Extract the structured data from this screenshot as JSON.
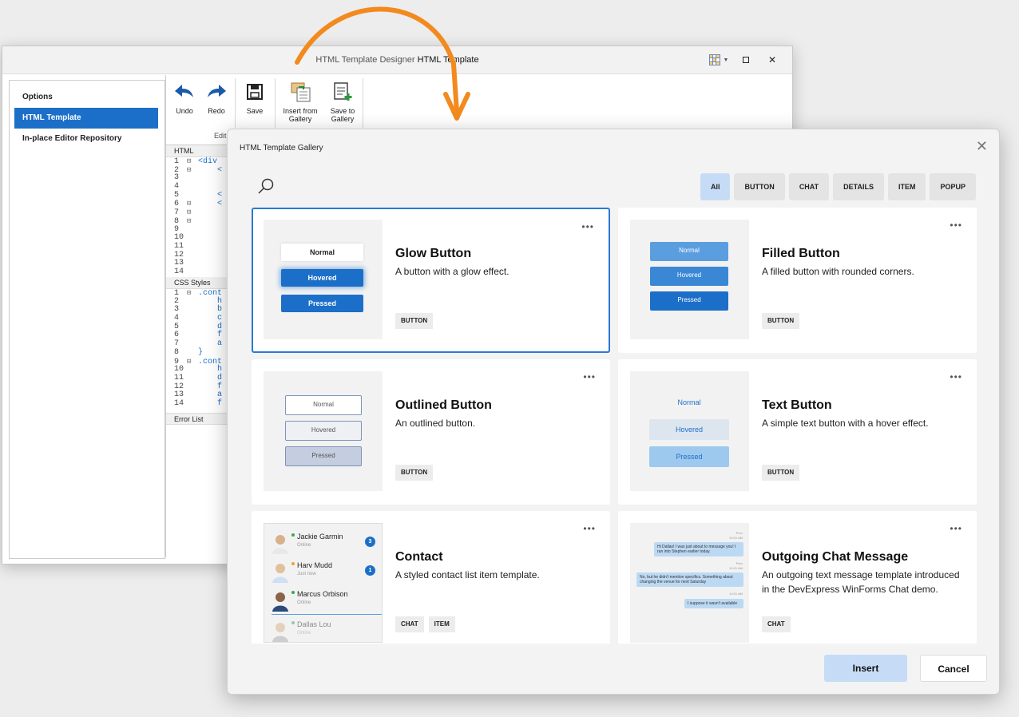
{
  "designer": {
    "title_prefix": "HTML Template Designer",
    "title_suffix": "HTML Template",
    "nav": [
      "Options",
      "HTML Template",
      "In-place Editor Repository"
    ],
    "ribbon": {
      "undo": "Undo",
      "redo": "Redo",
      "save": "Save",
      "insert_line1": "Insert from",
      "insert_line2": "Gallery",
      "saveto_line1": "Save to",
      "saveto_line2": "Gallery",
      "group_label": "Edit"
    },
    "html_panel": "HTML",
    "css_panel": "CSS Styles",
    "error_panel": "Error List",
    "html_lines": [
      {
        "n": "1",
        "f": "⊟",
        "t": "<div"
      },
      {
        "n": "2",
        "f": "⊟",
        "t": "    <"
      },
      {
        "n": "3",
        "f": "",
        "t": ""
      },
      {
        "n": "4",
        "f": "",
        "t": ""
      },
      {
        "n": "5",
        "f": "",
        "t": "    <"
      },
      {
        "n": "6",
        "f": "⊟",
        "t": "    <"
      },
      {
        "n": "7",
        "f": "⊟",
        "t": ""
      },
      {
        "n": "8",
        "f": "⊟",
        "t": ""
      },
      {
        "n": "9",
        "f": "",
        "t": ""
      },
      {
        "n": "10",
        "f": "",
        "t": ""
      },
      {
        "n": "11",
        "f": "",
        "t": ""
      },
      {
        "n": "12",
        "f": "",
        "t": ""
      },
      {
        "n": "13",
        "f": "",
        "t": ""
      },
      {
        "n": "14",
        "f": "",
        "t": ""
      }
    ],
    "css_lines": [
      {
        "n": "1",
        "f": "⊟",
        "t": ".cont"
      },
      {
        "n": "2",
        "f": "",
        "t": "    h"
      },
      {
        "n": "3",
        "f": "",
        "t": "    b"
      },
      {
        "n": "4",
        "f": "",
        "t": "    c"
      },
      {
        "n": "5",
        "f": "",
        "t": "    d"
      },
      {
        "n": "6",
        "f": "",
        "t": "    f"
      },
      {
        "n": "7",
        "f": "",
        "t": "    a"
      },
      {
        "n": "8",
        "f": "",
        "t": "}"
      },
      {
        "n": "9",
        "f": "⊟",
        "t": ".cont"
      },
      {
        "n": "10",
        "f": "",
        "t": "    h"
      },
      {
        "n": "11",
        "f": "",
        "t": "    d"
      },
      {
        "n": "12",
        "f": "",
        "t": "    f"
      },
      {
        "n": "13",
        "f": "",
        "t": "    a"
      },
      {
        "n": "14",
        "f": "",
        "t": "    f"
      }
    ]
  },
  "gallery": {
    "title": "HTML Template Gallery",
    "close": "✕",
    "filters": [
      "All",
      "BUTTON",
      "CHAT",
      "DETAILS",
      "ITEM",
      "POPUP"
    ],
    "cards": [
      {
        "title": "Glow Button",
        "desc": "A button with a glow effect.",
        "tags": [
          "BUTTON"
        ],
        "preview": [
          "Normal",
          "Hovered",
          "Pressed"
        ]
      },
      {
        "title": "Filled Button",
        "desc": "A filled button with rounded corners.",
        "tags": [
          "BUTTON"
        ],
        "preview": [
          "Normal",
          "Hovered",
          "Pressed"
        ]
      },
      {
        "title": "Outlined Button",
        "desc": "An outlined button.",
        "tags": [
          "BUTTON"
        ],
        "preview": [
          "Normal",
          "Hovered",
          "Pressed"
        ]
      },
      {
        "title": "Text Button",
        "desc": "A simple text button with a hover effect.",
        "tags": [
          "BUTTON"
        ],
        "preview": [
          "Normal",
          "Hovered",
          "Pressed"
        ]
      },
      {
        "title": "Contact",
        "desc": "A styled contact list item template.",
        "tags": [
          "CHAT",
          "ITEM"
        ]
      },
      {
        "title": "Outgoing Chat Message",
        "desc": "An outgoing text message template introduced in the DevExpress WinForms Chat demo.",
        "tags": [
          "CHAT"
        ]
      }
    ],
    "more": "•••",
    "contacts": [
      {
        "name": "Jackie Garmin",
        "status": "Online",
        "badge": "3"
      },
      {
        "name": "Harv Mudd",
        "status": "Just now",
        "badge": "1"
      },
      {
        "name": "Marcus Orbison",
        "status": "Online",
        "badge": ""
      },
      {
        "name": "Dallas Lou",
        "status": "Online",
        "badge": ""
      }
    ],
    "chat": {
      "msg1": "Hi Dallas! I was just about to message you! I ran into Stephen earlier today.",
      "msg2": "No, but he didn't mention specifics. Something about changing the venue for next Saturday",
      "msg3": "I suppose it wasn't available",
      "sender": "Prev",
      "time": "10:01 AM"
    },
    "insert": "Insert",
    "cancel": "Cancel"
  },
  "colors": {
    "accent": "#1c6fc8",
    "arrow": "#f28a1e",
    "selected_filter": "#c6dcf6"
  }
}
